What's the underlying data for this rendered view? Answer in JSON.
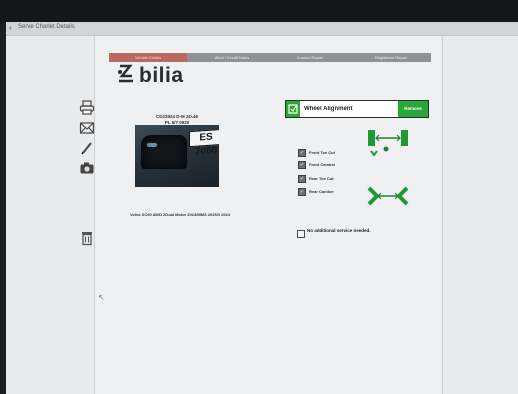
{
  "window": {
    "top_text_1": "",
    "top_text_2": "",
    "title": "Serve Charlet Details"
  },
  "tabs": [
    {
      "label": "Vehicle Details"
    },
    {
      "label": "Work / Credit Notes"
    },
    {
      "label": "Custom Repair"
    },
    {
      "label": "Registered Repair"
    }
  ],
  "brand": {
    "name": "bilia"
  },
  "vehicle": {
    "line1": "CD23924 D-M 2D.46",
    "line2": "PL 6/7 0920",
    "plate_visible": "ES 7060",
    "vin_line": "Volvo XC90 AWD 2Dual Motor 2024/MMS 2025/3 2024"
  },
  "service": {
    "search_value": "Wheel Alignment",
    "button_label": "Remove",
    "items": [
      {
        "label": "Front Toe Cut",
        "checked": true
      },
      {
        "label": "Front Camber",
        "checked": true
      },
      {
        "label": "Rear Toe Cut",
        "checked": true
      },
      {
        "label": "Rear Camber",
        "checked": true
      }
    ],
    "no_additional": "No additional service needed."
  },
  "colors": {
    "accent_green": "#2aa737",
    "tab_active": "#b86a5e",
    "tab_bar": "#8e9296"
  }
}
